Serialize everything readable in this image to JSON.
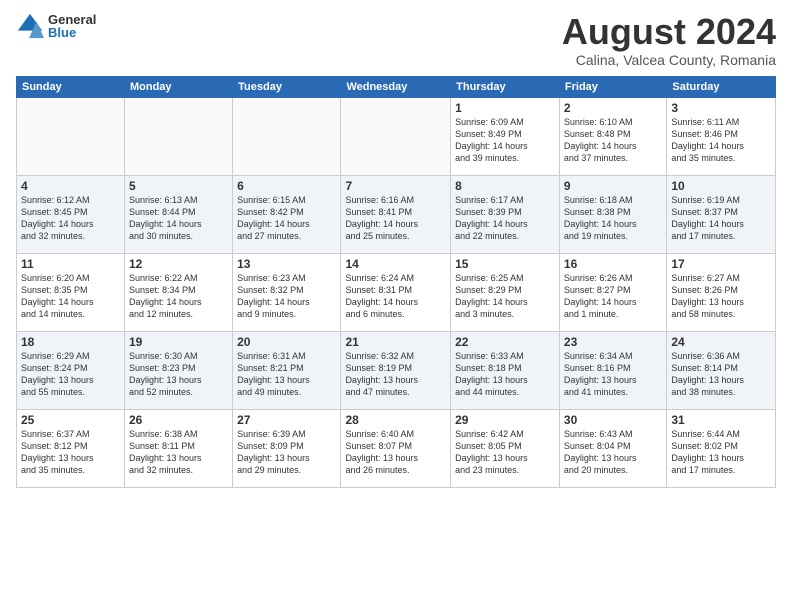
{
  "logo": {
    "general": "General",
    "blue": "Blue"
  },
  "title": "August 2024",
  "subtitle": "Calina, Valcea County, Romania",
  "days_header": [
    "Sunday",
    "Monday",
    "Tuesday",
    "Wednesday",
    "Thursday",
    "Friday",
    "Saturday"
  ],
  "weeks": [
    [
      {
        "num": "",
        "info": ""
      },
      {
        "num": "",
        "info": ""
      },
      {
        "num": "",
        "info": ""
      },
      {
        "num": "",
        "info": ""
      },
      {
        "num": "1",
        "info": "Sunrise: 6:09 AM\nSunset: 8:49 PM\nDaylight: 14 hours\nand 39 minutes."
      },
      {
        "num": "2",
        "info": "Sunrise: 6:10 AM\nSunset: 8:48 PM\nDaylight: 14 hours\nand 37 minutes."
      },
      {
        "num": "3",
        "info": "Sunrise: 6:11 AM\nSunset: 8:46 PM\nDaylight: 14 hours\nand 35 minutes."
      }
    ],
    [
      {
        "num": "4",
        "info": "Sunrise: 6:12 AM\nSunset: 8:45 PM\nDaylight: 14 hours\nand 32 minutes."
      },
      {
        "num": "5",
        "info": "Sunrise: 6:13 AM\nSunset: 8:44 PM\nDaylight: 14 hours\nand 30 minutes."
      },
      {
        "num": "6",
        "info": "Sunrise: 6:15 AM\nSunset: 8:42 PM\nDaylight: 14 hours\nand 27 minutes."
      },
      {
        "num": "7",
        "info": "Sunrise: 6:16 AM\nSunset: 8:41 PM\nDaylight: 14 hours\nand 25 minutes."
      },
      {
        "num": "8",
        "info": "Sunrise: 6:17 AM\nSunset: 8:39 PM\nDaylight: 14 hours\nand 22 minutes."
      },
      {
        "num": "9",
        "info": "Sunrise: 6:18 AM\nSunset: 8:38 PM\nDaylight: 14 hours\nand 19 minutes."
      },
      {
        "num": "10",
        "info": "Sunrise: 6:19 AM\nSunset: 8:37 PM\nDaylight: 14 hours\nand 17 minutes."
      }
    ],
    [
      {
        "num": "11",
        "info": "Sunrise: 6:20 AM\nSunset: 8:35 PM\nDaylight: 14 hours\nand 14 minutes."
      },
      {
        "num": "12",
        "info": "Sunrise: 6:22 AM\nSunset: 8:34 PM\nDaylight: 14 hours\nand 12 minutes."
      },
      {
        "num": "13",
        "info": "Sunrise: 6:23 AM\nSunset: 8:32 PM\nDaylight: 14 hours\nand 9 minutes."
      },
      {
        "num": "14",
        "info": "Sunrise: 6:24 AM\nSunset: 8:31 PM\nDaylight: 14 hours\nand 6 minutes."
      },
      {
        "num": "15",
        "info": "Sunrise: 6:25 AM\nSunset: 8:29 PM\nDaylight: 14 hours\nand 3 minutes."
      },
      {
        "num": "16",
        "info": "Sunrise: 6:26 AM\nSunset: 8:27 PM\nDaylight: 14 hours\nand 1 minute."
      },
      {
        "num": "17",
        "info": "Sunrise: 6:27 AM\nSunset: 8:26 PM\nDaylight: 13 hours\nand 58 minutes."
      }
    ],
    [
      {
        "num": "18",
        "info": "Sunrise: 6:29 AM\nSunset: 8:24 PM\nDaylight: 13 hours\nand 55 minutes."
      },
      {
        "num": "19",
        "info": "Sunrise: 6:30 AM\nSunset: 8:23 PM\nDaylight: 13 hours\nand 52 minutes."
      },
      {
        "num": "20",
        "info": "Sunrise: 6:31 AM\nSunset: 8:21 PM\nDaylight: 13 hours\nand 49 minutes."
      },
      {
        "num": "21",
        "info": "Sunrise: 6:32 AM\nSunset: 8:19 PM\nDaylight: 13 hours\nand 47 minutes."
      },
      {
        "num": "22",
        "info": "Sunrise: 6:33 AM\nSunset: 8:18 PM\nDaylight: 13 hours\nand 44 minutes."
      },
      {
        "num": "23",
        "info": "Sunrise: 6:34 AM\nSunset: 8:16 PM\nDaylight: 13 hours\nand 41 minutes."
      },
      {
        "num": "24",
        "info": "Sunrise: 6:36 AM\nSunset: 8:14 PM\nDaylight: 13 hours\nand 38 minutes."
      }
    ],
    [
      {
        "num": "25",
        "info": "Sunrise: 6:37 AM\nSunset: 8:12 PM\nDaylight: 13 hours\nand 35 minutes."
      },
      {
        "num": "26",
        "info": "Sunrise: 6:38 AM\nSunset: 8:11 PM\nDaylight: 13 hours\nand 32 minutes."
      },
      {
        "num": "27",
        "info": "Sunrise: 6:39 AM\nSunset: 8:09 PM\nDaylight: 13 hours\nand 29 minutes."
      },
      {
        "num": "28",
        "info": "Sunrise: 6:40 AM\nSunset: 8:07 PM\nDaylight: 13 hours\nand 26 minutes."
      },
      {
        "num": "29",
        "info": "Sunrise: 6:42 AM\nSunset: 8:05 PM\nDaylight: 13 hours\nand 23 minutes."
      },
      {
        "num": "30",
        "info": "Sunrise: 6:43 AM\nSunset: 8:04 PM\nDaylight: 13 hours\nand 20 minutes."
      },
      {
        "num": "31",
        "info": "Sunrise: 6:44 AM\nSunset: 8:02 PM\nDaylight: 13 hours\nand 17 minutes."
      }
    ]
  ]
}
